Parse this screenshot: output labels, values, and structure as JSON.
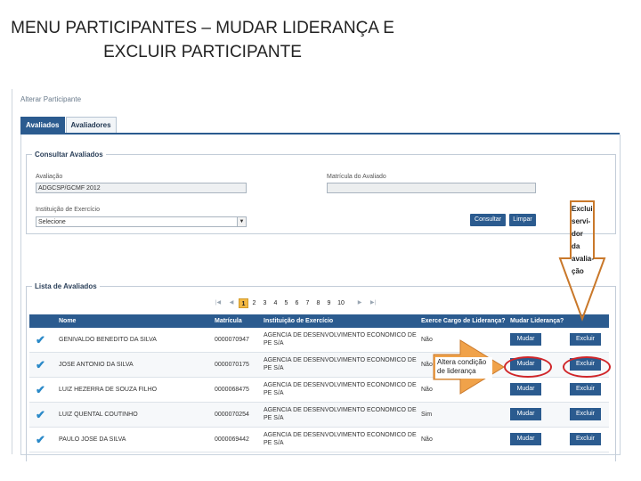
{
  "slide": {
    "title_line1": "MENU PARTICIPANTES – MUDAR LIDERANÇA E",
    "title_line2": "EXCLUIR PARTICIPANTE"
  },
  "app": {
    "breadcrumb": "Alterar Participante",
    "tabs": [
      {
        "label": "Avaliados",
        "active": true
      },
      {
        "label": "Avaliadores",
        "active": false
      }
    ]
  },
  "consultar": {
    "legend": "Consultar Avaliados",
    "avaliacao_label": "Avaliação",
    "avaliacao_value": "ADGCSP/GCMF 2012",
    "matricula_label": "Matrícula do Avaliado",
    "matricula_value": "",
    "instituicao_label": "Instituição de Exercício",
    "instituicao_selected": "Selecione",
    "consultar_button": "Consultar",
    "limpar_button": "Limpar"
  },
  "lista": {
    "legend": "Lista de Avaliados",
    "pages": [
      "1",
      "2",
      "3",
      "4",
      "5",
      "6",
      "7",
      "8",
      "9",
      "10"
    ],
    "current_page": "1",
    "columns": {
      "nome": "Nome",
      "matricula": "Matrícula",
      "instituicao": "Instituição de Exercício",
      "cargo": "Exerce Cargo de Liderança?",
      "mudar": "Mudar Liderança?"
    },
    "rows": [
      {
        "nome": "GENIVALDO BENEDITO DA SILVA",
        "matricula": "0000070947",
        "inst1": "AGENCIA DE DESENVOLVIMENTO ECONOMICO DE",
        "inst2": "PE S/A",
        "cargo": "Não",
        "mudar": "Mudar",
        "excluir": "Excluir"
      },
      {
        "nome": "JOSE ANTONIO DA SILVA",
        "matricula": "0000070175",
        "inst1": "AGENCIA DE DESENVOLVIMENTO ECONOMICO DE",
        "inst2": "PE S/A",
        "cargo": "Não",
        "mudar": "Mudar",
        "excluir": "Excluir"
      },
      {
        "nome": "LUIZ HEZERRA DE SOUZA FILHO",
        "matricula": "0000068475",
        "inst1": "AGENCIA DE DESENVOLVIMENTO ECONOMICO DE",
        "inst2": "PE S/A",
        "cargo": "Não",
        "mudar": "Mudar",
        "excluir": "Excluir"
      },
      {
        "nome": "LUIZ QUENTAL COUTINHO",
        "matricula": "0000070254",
        "inst1": "AGENCIA DE DESENVOLVIMENTO ECONOMICO DE",
        "inst2": "PE S/A",
        "cargo": "Sim",
        "mudar": "Mudar",
        "excluir": "Excluir"
      },
      {
        "nome": "PAULO JOSE DA SILVA",
        "matricula": "0000069442",
        "inst1": "AGENCIA DE DESENVOLVIMENTO ECONOMICO DE",
        "inst2": "PE S/A",
        "cargo": "Não",
        "mudar": "Mudar",
        "excluir": "Excluir"
      }
    ]
  },
  "annotations": {
    "exclui_lines": [
      "Exclui",
      "servi-",
      "dor da",
      "avalia-",
      "ção"
    ],
    "altera_lines": [
      "Altera condição",
      "de liderança"
    ],
    "arrow_color": "#f0a24a",
    "arrow_stroke": "#c9782a",
    "oval_color": "#d0262a"
  }
}
